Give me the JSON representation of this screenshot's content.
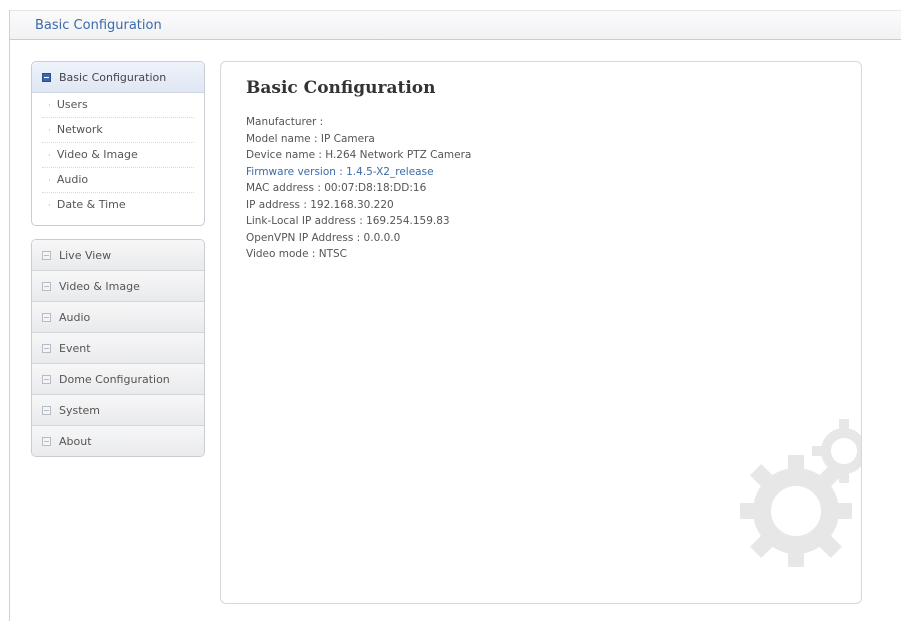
{
  "header": {
    "title": "Basic Configuration"
  },
  "sidebar": {
    "active_group": {
      "label": "Basic Configuration",
      "items": [
        {
          "label": "Users"
        },
        {
          "label": "Network"
        },
        {
          "label": "Video & Image"
        },
        {
          "label": "Audio"
        },
        {
          "label": "Date & Time"
        }
      ]
    },
    "menu": [
      {
        "label": "Live View"
      },
      {
        "label": "Video & Image"
      },
      {
        "label": "Audio"
      },
      {
        "label": "Event"
      },
      {
        "label": "Dome Configuration"
      },
      {
        "label": "System"
      },
      {
        "label": "About"
      }
    ]
  },
  "main": {
    "title": "Basic Configuration",
    "info": [
      "Manufacturer :",
      "Model name : IP Camera",
      "Device name : H.264 Network PTZ Camera",
      "Firmware version : 1.4.5-X2_release",
      "MAC address : 00:07:D8:18:DD:16",
      "IP address : 192.168.30.220",
      "Link-Local IP address : 169.254.159.83",
      "OpenVPN IP Address : 0.0.0.0",
      "Video mode : NTSC"
    ]
  },
  "colors": {
    "accent": "#3b6aa8",
    "active_icon": "#3f65a8"
  }
}
